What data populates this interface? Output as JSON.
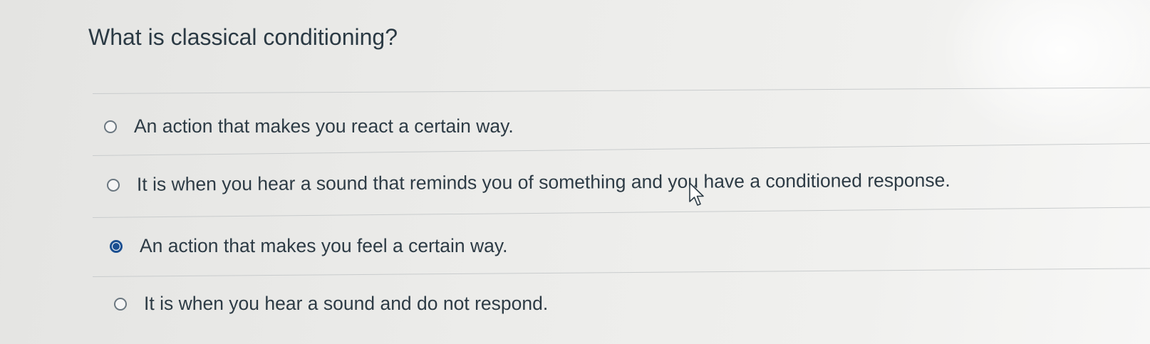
{
  "question": {
    "text": "What is classical conditioning?"
  },
  "answers": [
    {
      "label": "An action that makes you react a certain way.",
      "selected": false
    },
    {
      "label": "It is when you hear a sound that reminds you of something and you have a conditioned response.",
      "selected": false
    },
    {
      "label": "An action that makes you feel a certain way.",
      "selected": true
    },
    {
      "label": "It is when you hear a sound and do not respond.",
      "selected": false
    }
  ],
  "colors": {
    "selected_radio": "#1b4f91",
    "text": "#2d3b45",
    "divider": "#c9cccd"
  },
  "icons": {
    "cursor": "mouse-pointer-icon"
  }
}
